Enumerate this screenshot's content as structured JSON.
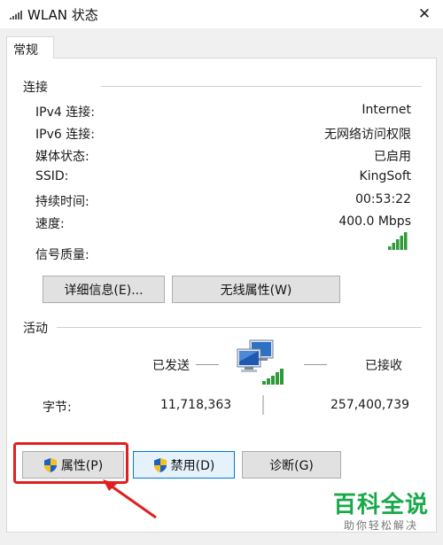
{
  "window": {
    "title": "WLAN 状态",
    "close_glyph": "✕"
  },
  "tab": {
    "label": "常规"
  },
  "connection": {
    "group_label": "连接",
    "rows": [
      {
        "label": "IPv4 连接:",
        "value": "Internet"
      },
      {
        "label": "IPv6 连接:",
        "value": "无网络访问权限"
      },
      {
        "label": "媒体状态:",
        "value": "已启用"
      },
      {
        "label": "SSID:",
        "value": "KingSoft"
      },
      {
        "label": "持续时间:",
        "value": "00:53:22"
      },
      {
        "label": "速度:",
        "value": "400.0 Mbps"
      }
    ],
    "signal_label": "信号质量:",
    "signal_level": 5,
    "signal_max": 5,
    "details_button": "详细信息(E)...",
    "wireless_button": "无线属性(W)"
  },
  "activity": {
    "group_label": "活动",
    "sent_label": "已发送",
    "received_label": "已接收",
    "bytes_label": "字节:",
    "bytes_sent": "11,718,363",
    "bytes_received": "257,400,739"
  },
  "buttons": {
    "properties": "属性(P)",
    "disable": "禁用(D)",
    "diagnose": "诊断(G)"
  },
  "colors": {
    "accent": "#0078d7",
    "signal": "#2e9a3a",
    "annotation": "#e02020",
    "watermark": "#19a94a"
  },
  "watermark": {
    "main": "百科全说",
    "sub": "助你轻松解决"
  }
}
